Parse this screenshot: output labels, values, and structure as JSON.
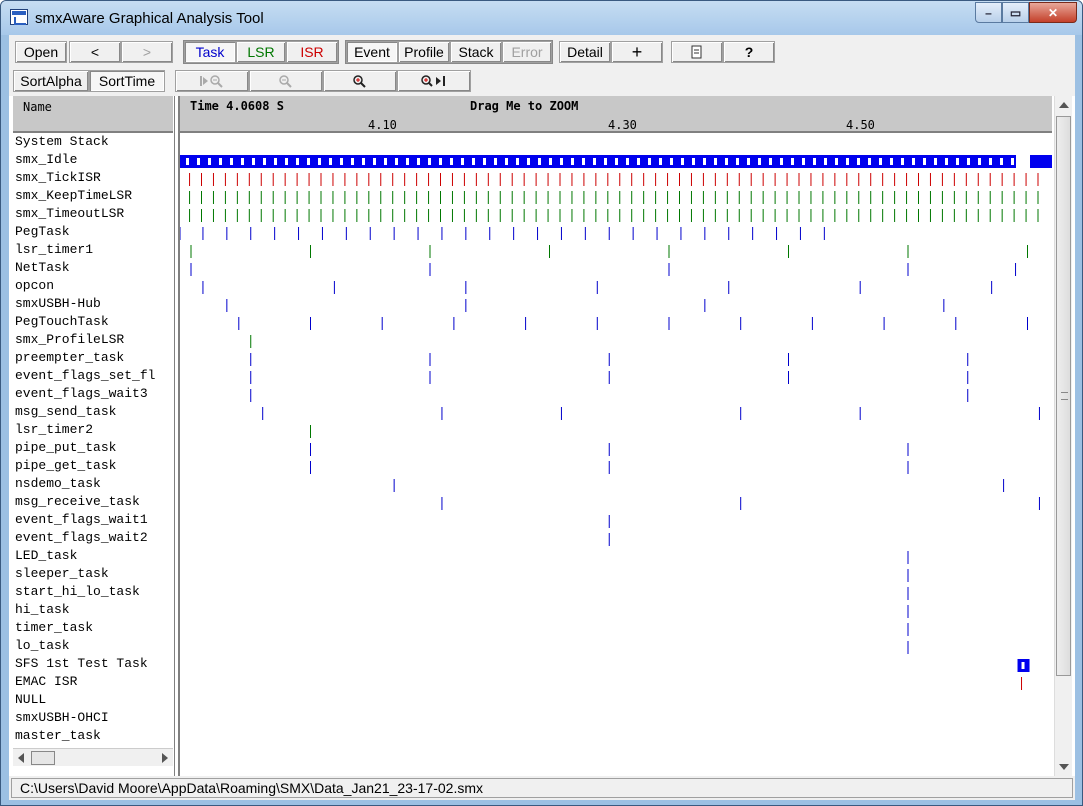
{
  "window": {
    "title": "smxAware Graphical Analysis Tool"
  },
  "caption": {
    "minimize": "–",
    "maximize": "▭",
    "close": "✕"
  },
  "toolbar1": {
    "open": "Open",
    "back": "<",
    "forward": ">",
    "task": "Task",
    "lsr": "LSR",
    "isr": "ISR",
    "event": "Event",
    "profile": "Profile",
    "stack": "Stack",
    "error": "Error",
    "detail": "Detail",
    "crosshair": "+",
    "help": "?"
  },
  "toolbar2": {
    "sort_alpha": "SortAlpha",
    "sort_time": "SortTime"
  },
  "colors": {
    "task": "#0000cc",
    "lsr": "#007700",
    "isr": "#cc0000",
    "bar": "#0000ee"
  },
  "names_header": "Name",
  "graph_header": {
    "time": "Time 4.0608 S",
    "zoom_hint": "Drag Me to ZOOM",
    "ticks": [
      "4.10",
      "4.30",
      "4.50"
    ]
  },
  "rows": [
    {
      "name": "System Stack",
      "color": "task",
      "marks": []
    },
    {
      "name": "smx_Idle",
      "color": "bar",
      "marks": []
    },
    {
      "name": "smx_TickISR",
      "color": "isr",
      "marks": "tick"
    },
    {
      "name": "smx_KeepTimeLSR",
      "color": "lsr",
      "marks": "tick"
    },
    {
      "name": "smx_TimeoutLSR",
      "color": "lsr",
      "marks": "tick"
    },
    {
      "name": "PegTask",
      "color": "task",
      "marks": [
        4.0608,
        4.08,
        4.1,
        4.12,
        4.14,
        4.16,
        4.18,
        4.2,
        4.22,
        4.24,
        4.26,
        4.28,
        4.3,
        4.32,
        4.34,
        4.36,
        4.38,
        4.4,
        4.42,
        4.44,
        4.46,
        4.48,
        4.5,
        4.52,
        4.54,
        4.56,
        4.58,
        4.6
      ]
    },
    {
      "name": "lsr_timer1",
      "color": "lsr",
      "marks": [
        4.07,
        4.17,
        4.27,
        4.37,
        4.47,
        4.57,
        4.67,
        4.77
      ]
    },
    {
      "name": "NetTask",
      "color": "task",
      "marks": [
        4.07,
        4.27,
        4.47,
        4.67,
        4.76
      ]
    },
    {
      "name": "opcon",
      "color": "task",
      "marks": [
        4.08,
        4.19,
        4.3,
        4.41,
        4.52,
        4.63,
        4.74
      ]
    },
    {
      "name": "smxUSBH-Hub",
      "color": "task",
      "marks": [
        4.1,
        4.3,
        4.5,
        4.7
      ]
    },
    {
      "name": "PegTouchTask",
      "color": "task",
      "marks": [
        4.11,
        4.17,
        4.23,
        4.29,
        4.35,
        4.41,
        4.47,
        4.53,
        4.59,
        4.65,
        4.71,
        4.77
      ]
    },
    {
      "name": "smx_ProfileLSR",
      "color": "lsr",
      "marks": [
        4.12
      ]
    },
    {
      "name": "preempter_task",
      "color": "task",
      "marks": [
        4.12,
        4.27,
        4.42,
        4.57,
        4.72
      ]
    },
    {
      "name": "event_flags_set_fl",
      "color": "task",
      "marks": [
        4.12,
        4.27,
        4.42,
        4.57,
        4.72
      ]
    },
    {
      "name": "event_flags_wait3",
      "color": "task",
      "marks": [
        4.12,
        4.72
      ]
    },
    {
      "name": "msg_send_task",
      "color": "task",
      "marks": [
        4.13,
        4.28,
        4.38,
        4.53,
        4.63,
        4.78
      ]
    },
    {
      "name": "lsr_timer2",
      "color": "lsr",
      "marks": [
        4.17
      ]
    },
    {
      "name": "pipe_put_task",
      "color": "task",
      "marks": [
        4.17,
        4.42,
        4.67
      ]
    },
    {
      "name": "pipe_get_task",
      "color": "task",
      "marks": [
        4.17,
        4.42,
        4.67
      ]
    },
    {
      "name": "nsdemo_task",
      "color": "task",
      "marks": [
        4.24,
        4.75
      ]
    },
    {
      "name": "msg_receive_task",
      "color": "task",
      "marks": [
        4.28,
        4.53,
        4.78
      ]
    },
    {
      "name": "event_flags_wait1",
      "color": "task",
      "marks": [
        4.42
      ]
    },
    {
      "name": "event_flags_wait2",
      "color": "task",
      "marks": [
        4.42
      ]
    },
    {
      "name": "LED_task",
      "color": "task",
      "marks": [
        4.67
      ]
    },
    {
      "name": "sleeper_task",
      "color": "task",
      "marks": [
        4.67
      ]
    },
    {
      "name": "start_hi_lo_task",
      "color": "task",
      "marks": [
        4.67
      ]
    },
    {
      "name": "hi_task",
      "color": "task",
      "marks": [
        4.67
      ]
    },
    {
      "name": "timer_task",
      "color": "task",
      "marks": [
        4.67
      ]
    },
    {
      "name": "lo_task",
      "color": "task",
      "marks": [
        4.67
      ]
    },
    {
      "name": "SFS 1st Test Task",
      "color": "bar",
      "marks": [
        4.765
      ]
    },
    {
      "name": "EMAC ISR",
      "color": "isr",
      "marks": [
        4.765
      ]
    },
    {
      "name": "NULL",
      "color": "task",
      "marks": []
    },
    {
      "name": "smxUSBH-OHCI",
      "color": "task",
      "marks": []
    },
    {
      "name": "master_task",
      "color": "task",
      "marks": []
    }
  ],
  "time_axis": {
    "start": 4.0608,
    "tick_values": [
      4.1,
      4.3,
      4.5
    ]
  },
  "status": "C:\\Users\\David Moore\\AppData\\Roaming\\SMX\\Data_Jan21_23-17-02.smx"
}
